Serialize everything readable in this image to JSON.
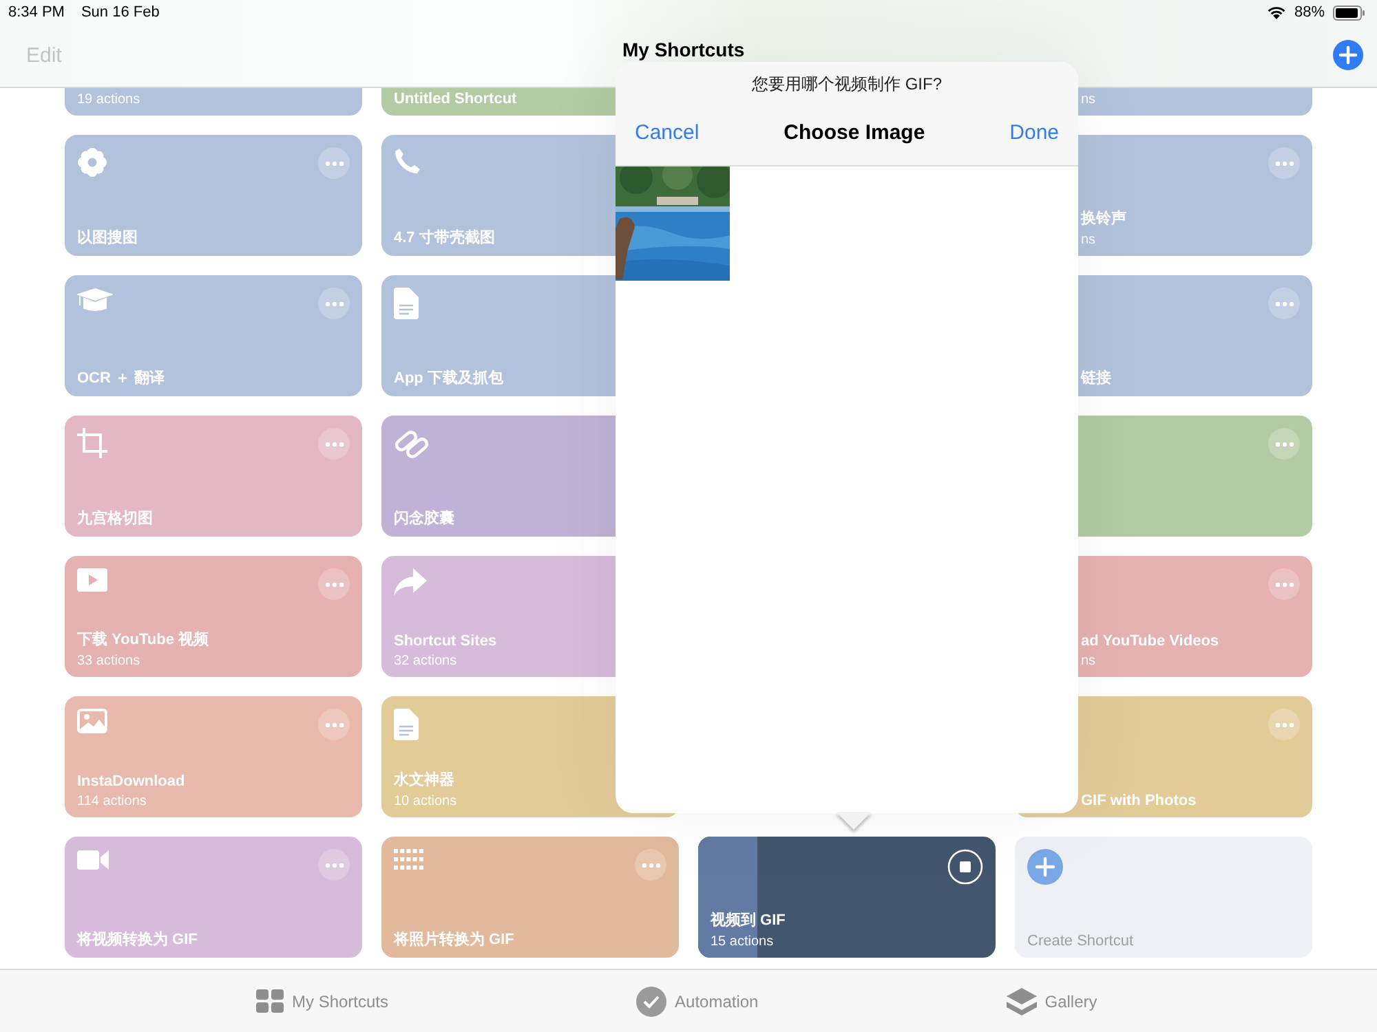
{
  "status_bar": {
    "time": "8:34 PM",
    "date": "Sun 16 Feb",
    "battery": "88%"
  },
  "nav": {
    "edit": "Edit",
    "title": "My Shortcuts"
  },
  "cards": [
    {
      "kind": "shortcut",
      "subtitle": "19 actions",
      "color": "#b3c2dc"
    },
    {
      "kind": "shortcut",
      "title": "Untitled Shortcut",
      "color": "#b2cba2"
    },
    {
      "kind": "partial",
      "subtitle": "ns",
      "color": "#b3c2dc"
    },
    {
      "kind": "shortcut",
      "title": "以图搜图",
      "color": "#b3c2dc",
      "menu": true
    },
    {
      "kind": "shortcut",
      "title": "4.7 寸带壳截图",
      "color": "#b3c2dc"
    },
    {
      "kind": "partial",
      "title": "换铃声",
      "subtitle": "ns",
      "color": "#b3c2dc",
      "menu": true
    },
    {
      "kind": "shortcut",
      "title": "OCR ＋ 翻译",
      "color": "#b3c2dc",
      "menu": true
    },
    {
      "kind": "shortcut",
      "title": "App 下载及抓包",
      "color": "#b3c2dc"
    },
    {
      "kind": "partial",
      "title": "链接",
      "color": "#b3c2dc",
      "menu": true
    },
    {
      "kind": "shortcut",
      "title": "九宫格切图",
      "color": "#e4b8c3",
      "menu": true
    },
    {
      "kind": "shortcut",
      "title": "闪念胶囊",
      "color": "#c0b2d6"
    },
    {
      "kind": "partial",
      "color": "#b2cba2",
      "menu": true
    },
    {
      "kind": "shortcut",
      "title": "下载 YouTube 视频",
      "subtitle": "33 actions",
      "color": "#e6b1b1",
      "menu": true
    },
    {
      "kind": "shortcut",
      "title": "Shortcut Sites",
      "subtitle": "32 actions",
      "color": "#d6bbda"
    },
    {
      "kind": "partial",
      "title": "ad YouTube Videos",
      "subtitle": "ns",
      "color": "#e6b1b1",
      "menu": true
    },
    {
      "kind": "shortcut",
      "title": "InstaDownload",
      "subtitle": "114 actions",
      "color": "#e9b9ad",
      "menu": true
    },
    {
      "kind": "shortcut",
      "title": "水文神器",
      "subtitle": "10 actions",
      "color": "#e3cb98"
    },
    {
      "kind": "partial",
      "title": "GIF with Photos",
      "color": "#e3cb98",
      "menu": true
    },
    {
      "kind": "shortcut",
      "title": "将视频转换为 GIF",
      "color": "#d6bbda",
      "menu": true
    },
    {
      "kind": "shortcut",
      "title": "将照片转换为 GIF",
      "color": "#e2b99c",
      "menu": true
    },
    {
      "kind": "running",
      "title": "视频到 GIF",
      "subtitle": "15 actions",
      "color": "#44556f",
      "level": 0.2
    },
    {
      "kind": "create",
      "title": "Create Shortcut",
      "color": "#eef0f5"
    }
  ],
  "popover": {
    "prompt": "您要用哪个视频制作 GIF?",
    "cancel": "Cancel",
    "title": "Choose Image",
    "done": "Done"
  },
  "tabs": [
    {
      "label": "My Shortcuts"
    },
    {
      "label": "Automation"
    },
    {
      "label": "Gallery"
    }
  ]
}
